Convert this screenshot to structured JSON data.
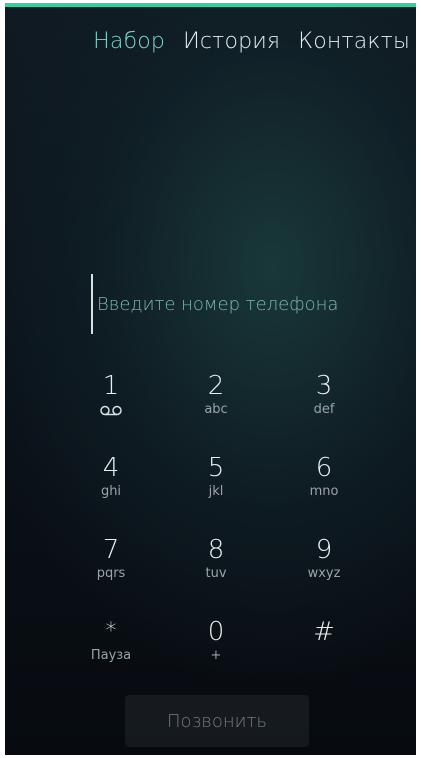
{
  "tabs": [
    {
      "label": "Набор",
      "active": true
    },
    {
      "label": "История",
      "active": false
    },
    {
      "label": "Контакты",
      "active": false
    }
  ],
  "number_field": {
    "placeholder": "Введите номер телефона",
    "value": ""
  },
  "keypad": [
    {
      "digit": "1",
      "letters": "",
      "icon": "voicemail-icon"
    },
    {
      "digit": "2",
      "letters": "abc"
    },
    {
      "digit": "3",
      "letters": "def"
    },
    {
      "digit": "4",
      "letters": "ghi"
    },
    {
      "digit": "5",
      "letters": "jkl"
    },
    {
      "digit": "6",
      "letters": "mno"
    },
    {
      "digit": "7",
      "letters": "pqrs"
    },
    {
      "digit": "8",
      "letters": "tuv"
    },
    {
      "digit": "9",
      "letters": "wxyz"
    },
    {
      "digit": "*",
      "letters": "Пауза"
    },
    {
      "digit": "0",
      "letters": "+"
    },
    {
      "digit": "#",
      "letters": ""
    }
  ],
  "call_button": {
    "label": "Позвонить"
  },
  "colors": {
    "accent": "#2ed0a4",
    "active_tab": "#7fd6cb",
    "placeholder": "#7fb8b0"
  }
}
